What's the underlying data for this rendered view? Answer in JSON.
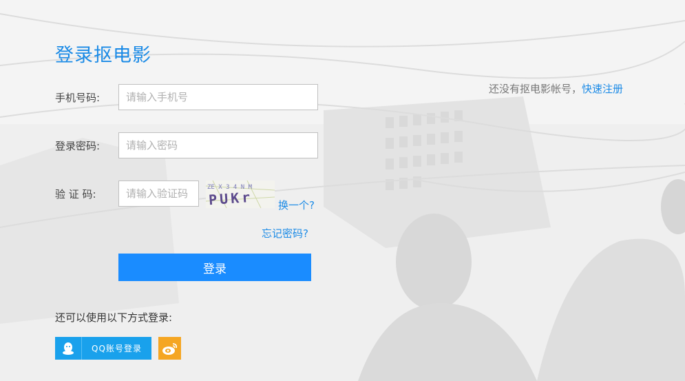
{
  "page_title": "登录抠电影",
  "register": {
    "prompt": "还没有抠电影帐号，",
    "link": "快速注册"
  },
  "fields": {
    "phone": {
      "label": "手机号码:",
      "placeholder": "请输入手机号",
      "value": ""
    },
    "password": {
      "label": "登录密码:",
      "placeholder": "请输入密码",
      "value": ""
    },
    "captcha": {
      "label": "验 证 码:",
      "placeholder": "请输入验证码",
      "value": ""
    }
  },
  "captcha_image": {
    "text": "PUKr",
    "noise": "ZE X 3 4 N M"
  },
  "refresh_captcha": "换一个?",
  "forgot_password": "忘记密码?",
  "login_button": "登录",
  "alt_login": {
    "title": "还可以使用以下方式登录:",
    "qq_label": "QQ账号登录"
  },
  "colors": {
    "accent": "#1a8ae6",
    "button": "#1a8cff",
    "qq": "#19a1ec",
    "weibo": "#f5a623"
  },
  "icons": [
    "qq-icon",
    "weibo-icon"
  ]
}
